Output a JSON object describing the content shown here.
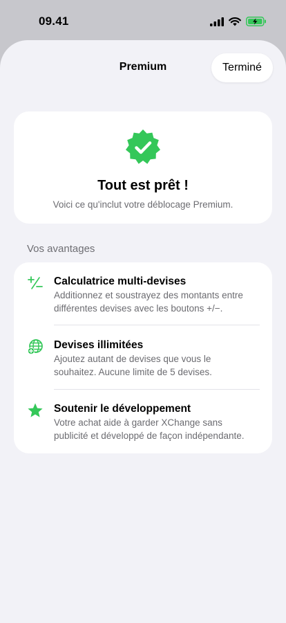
{
  "status_bar": {
    "time": "09.41"
  },
  "colors": {
    "accent": "#34c759",
    "background": "#f2f2f7",
    "card": "#ffffff",
    "secondary_text": "#6b6b70"
  },
  "nav": {
    "title": "Premium",
    "done_label": "Terminé"
  },
  "hero": {
    "title": "Tout est prêt !",
    "subtitle": "Voici ce qu'inclut votre déblocage Premium.",
    "icon": "checkmark-seal-icon"
  },
  "benefits_section": {
    "header": "Vos avantages",
    "items": [
      {
        "icon": "plus-minus-icon",
        "title": "Calculatrice multi-devises",
        "description_line1": "Additionnez et soustrayez des montants entre",
        "description_line2": "différentes devises avec les boutons +/−."
      },
      {
        "icon": "globe-icon",
        "title": "Devises illimitées",
        "description_line1": "Ajoutez autant de devises que vous le",
        "description_line2": "souhaitez. Aucune limite de 5 devises."
      },
      {
        "icon": "star-icon",
        "title": "Soutenir le développement",
        "description_line1": "Votre achat aide à garder XChange sans",
        "description_line2": "publicité et développé de façon indépendante."
      }
    ]
  }
}
